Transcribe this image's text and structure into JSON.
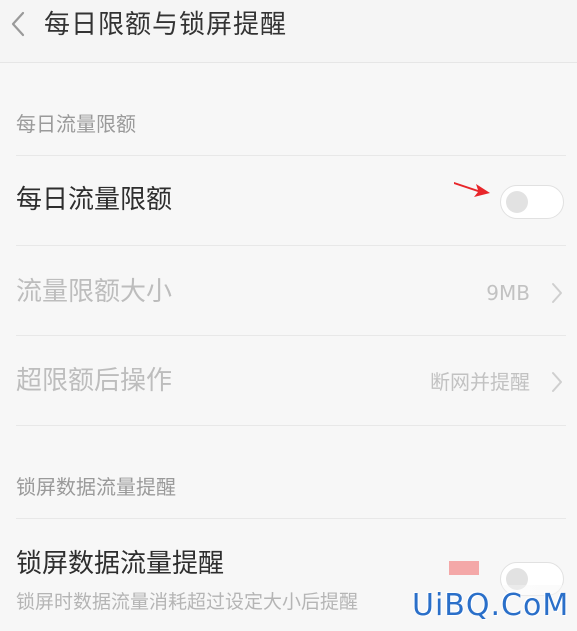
{
  "header": {
    "title": "每日限额与锁屏提醒",
    "back_icon": "chevron-left-icon"
  },
  "section_daily": {
    "header": "每日流量限额",
    "rows": {
      "daily_limit": {
        "label": "每日流量限额",
        "toggle_on": false
      },
      "limit_size": {
        "label": "流量限额大小",
        "value": "9MB"
      },
      "over_limit_action": {
        "label": "超限额后操作",
        "value": "断网并提醒"
      }
    }
  },
  "section_lockscreen": {
    "header": "锁屏数据流量提醒",
    "rows": {
      "lockscreen_reminder": {
        "label": "锁屏数据流量提醒",
        "description": "锁屏时数据流量消耗超过设定大小后提醒",
        "toggle_on": false
      }
    }
  },
  "annotation": {
    "arrow_icon": "red-arrow-icon",
    "color": "#e8262a"
  },
  "watermark": {
    "text": "UiBQ.CoM"
  }
}
